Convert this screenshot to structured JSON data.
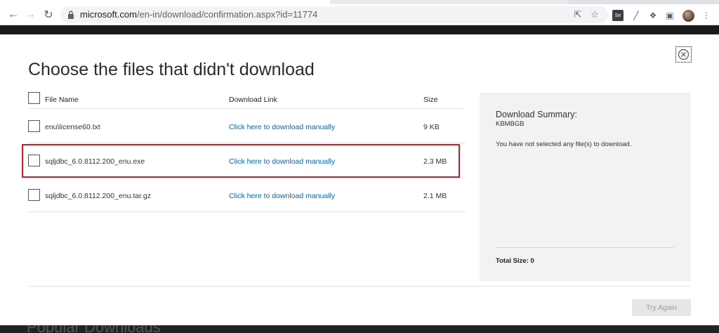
{
  "browser": {
    "url_host": "microsoft.com",
    "url_path": "/en-in/download/confirmation.aspx?id=11774",
    "extension_badge": "Se"
  },
  "background_page": {
    "section_heading": "Popular Downloads"
  },
  "modal": {
    "title": "Choose the files that didn't download",
    "columns": {
      "name": "File Name",
      "link": "Download Link",
      "size": "Size"
    },
    "files": [
      {
        "name": "enu\\license60.txt",
        "link": "Click here to download manually",
        "size": "9 KB"
      },
      {
        "name": "sqljdbc_6.0.8112.200_enu.exe",
        "link": "Click here to download manually",
        "size": "2.3 MB"
      },
      {
        "name": "sqljdbc_6.0.8112.200_enu.tar.gz",
        "link": "Click here to download manually",
        "size": "2.1 MB"
      }
    ],
    "summary": {
      "title": "Download Summary:",
      "subtitle": "KBMBGB",
      "message": "You have not selected any file(s) to download.",
      "total": "Total Size: 0"
    },
    "retry_label": "Try Again"
  },
  "colors": {
    "link": "#0067b8",
    "highlight": "#e0141e",
    "summary_bg": "#f2f2f2"
  }
}
